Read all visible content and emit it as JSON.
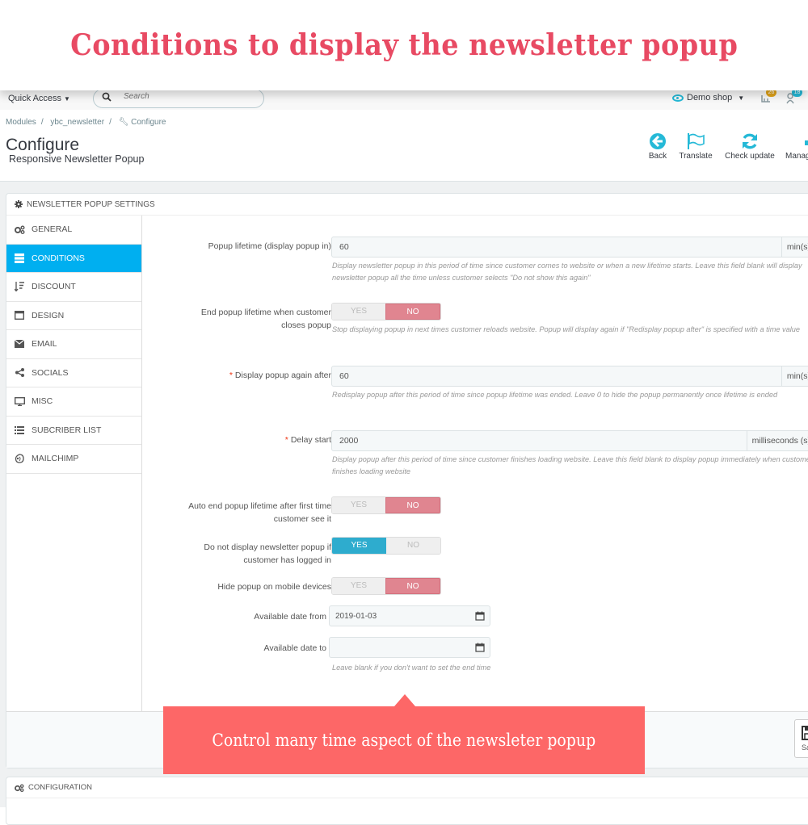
{
  "banner": {
    "title": "Conditions to display the newsletter popup"
  },
  "topbar": {
    "quick_access": "Quick Access",
    "search_placeholder": "Search",
    "shop_name": "Demo shop",
    "notifications": [
      {
        "icon": "cart-icon",
        "count": "26",
        "color": "#e0a31a"
      },
      {
        "icon": "customers-icon",
        "count": "18",
        "color": "#25b9d7"
      }
    ]
  },
  "breadcrumb": [
    "Modules",
    "ybc_newsletter",
    "Configure"
  ],
  "header": {
    "title": "Configure",
    "subtitle": "Responsive Newsletter Popup",
    "toolbar": [
      {
        "label": "Back",
        "icon": "back-arrow-icon"
      },
      {
        "label": "Translate",
        "icon": "flag-icon"
      },
      {
        "label": "Check update",
        "icon": "refresh-icon"
      },
      {
        "label": "Manage hooks",
        "icon": "anchor-icon"
      }
    ]
  },
  "panel": {
    "heading": "NEWSLETTER POPUP SETTINGS",
    "nav": [
      {
        "label": "GENERAL",
        "icon": "cogs-icon",
        "active": false
      },
      {
        "label": "CONDITIONS",
        "icon": "server-icon",
        "active": true
      },
      {
        "label": "DISCOUNT",
        "icon": "sort-icon",
        "active": false
      },
      {
        "label": "DESIGN",
        "icon": "window-icon",
        "active": false
      },
      {
        "label": "EMAIL",
        "icon": "envelope-icon",
        "active": false
      },
      {
        "label": "SOCIALS",
        "icon": "share-icon",
        "active": false
      },
      {
        "label": "MISC",
        "icon": "desktop-icon",
        "active": false
      },
      {
        "label": "SUBCRIBER LIST",
        "icon": "list-icon",
        "active": false
      },
      {
        "label": "MAILCHIMP",
        "icon": "mailchimp-icon",
        "active": false
      }
    ],
    "fields": {
      "lifetime": {
        "label": "Popup lifetime (display popup in)",
        "value": "60",
        "unit": "min(s)",
        "help": "Display newsletter popup in this period of time since customer comes to website or when a new lifetime starts. Leave this field blank will display newsletter popup all the time unless customer selects \"Do not show this again\""
      },
      "end_on_close": {
        "label": "End popup lifetime when customer closes popup",
        "yes": "YES",
        "no": "NO",
        "value": "NO",
        "help": "Stop displaying popup in next times customer reloads website. Popup will display again if \"Redisplay popup after\" is specified with a time value"
      },
      "display_again": {
        "label": "Display popup again after",
        "required": "*",
        "value": "60",
        "unit": "min(s)",
        "help": "Redisplay popup after this period of time since popup lifetime was ended. Leave 0 to hide the popup permanently once lifetime is ended"
      },
      "delay_start": {
        "label": "Delay start",
        "required": "*",
        "value": "2000",
        "unit": "milliseconds (s)",
        "help": "Display popup after this period of time since customer finishes loading website. Leave this field blank to display popup immediately when customer finishes loading website"
      },
      "auto_end": {
        "label": "Auto end popup lifetime after first time customer see it",
        "yes": "YES",
        "no": "NO",
        "value": "NO"
      },
      "hide_logged_in": {
        "label": "Do not display newsletter popup if customer has logged in",
        "yes": "YES",
        "no": "NO",
        "value": "YES"
      },
      "hide_mobile": {
        "label": "Hide popup on mobile devices",
        "yes": "YES",
        "no": "NO",
        "value": "NO"
      },
      "date_from": {
        "label": "Available date from",
        "value": "2019-01-03"
      },
      "date_to": {
        "label": "Available date to",
        "value": "",
        "help": "Leave blank if you don't want to set the end time"
      }
    },
    "save_label": "Save"
  },
  "callout": {
    "text": "Control many time aspect of the newsleter popup"
  },
  "config_panel": {
    "heading": "CONFIGURATION"
  }
}
